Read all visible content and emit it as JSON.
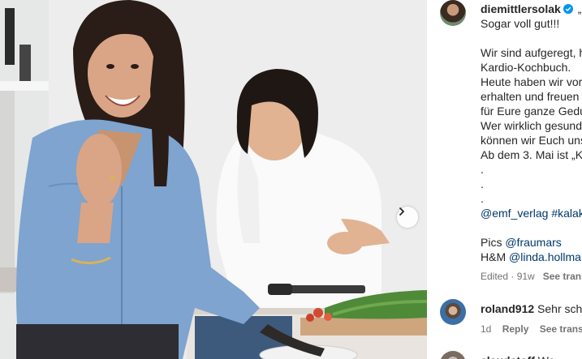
{
  "post": {
    "next_label": "Next"
  },
  "caption": {
    "username": "diemittlersolak",
    "first_line_rest": "„K",
    "lines": [
      "Sogar voll gut!!!",
      "",
      "Wir sind aufgeregt, h",
      "Kardio-Kochbuch.",
      "Heute haben wir vor",
      "erhalten und freuen",
      "für Eure ganze Gedu",
      "Wer wirklich gesund",
      "können wir Euch uns",
      "Ab dem 3. Mai ist „K",
      ".",
      ".",
      "."
    ],
    "tags_a": "@emf_verlag",
    "tags_b": "#kalak",
    "pics_label": "Pics",
    "pics_handle": "@fraumars",
    "hm_label": "H&M",
    "hm_handle": "@linda.hollma",
    "edited": "Edited · 91w",
    "see_translation": "See transl"
  },
  "comments": [
    {
      "username": "roland912",
      "text": "Sehr schö",
      "age": "1d",
      "reply": "Reply",
      "see_translation": "See translat"
    },
    {
      "username": "claudstoff",
      "text": "We"
    }
  ],
  "colors": {
    "link": "#00376b",
    "verified": "#0095f6",
    "meta": "#737373"
  }
}
